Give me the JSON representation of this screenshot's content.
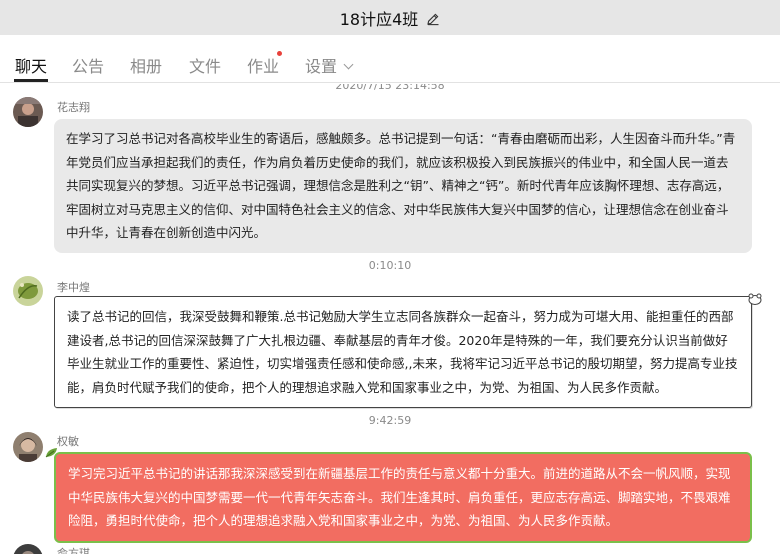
{
  "header": {
    "title": "18计应4班"
  },
  "tabs": [
    {
      "label": "聊天"
    },
    {
      "label": "公告"
    },
    {
      "label": "相册"
    },
    {
      "label": "文件"
    },
    {
      "label": "作业"
    },
    {
      "label": "设置"
    }
  ],
  "colors": {
    "active_tab": "#111111",
    "inactive_tab": "#8a8a8a",
    "notification_dot": "#e8413b",
    "bubble_gray": "#e9e9e9",
    "bubble_red": "#f26d61",
    "bubble_red_border": "#7bbf4a"
  },
  "chat": {
    "top_timestamp": "2020/7/15 23:14:58",
    "messages": [
      {
        "sender": "花志翔",
        "avatar_icon": "photo-avatar",
        "text": "在学习了习总书记对各高校毕业生的寄语后，感触颇多。总书记提到一句话：“青春由磨砺而出彩，人生因奋斗而升华。”青年党员们应当承担起我们的责任，作为肩负着历史使命的我们，就应该积极投入到民族振兴的伟业中，和全国人民一道去共同实现复兴的梦想。习近平总书记强调，理想信念是胜利之“钥”、精神之“钙”。新时代青年应该胸怀理想、志存高远，牢固树立对马克思主义的信仰、对中国特色社会主义的信念、对中华民族伟大复兴中国梦的信心，让理想信念在创业奋斗中升华，让青春在创新创造中闪光。"
      },
      {
        "timestamp": "0:10:10",
        "sender": "李中煌",
        "avatar_icon": "leaf-avatar",
        "text": "读了总书记的回信，我深受鼓舞和鞭策.总书记勉励大学生立志同各族群众一起奋斗，努力成为可堪大用、能担重任的西部建设者,总书记的回信深深鼓舞了广大扎根边疆、奉献基层的青年才俊。2020年是特殊的一年，我们要充分认识当前做好毕业生就业工作的重要性、紧迫性，切实增强责任感和使命感,,未来，我将牢记习近平总书记的殷切期望，努力提高专业技能，肩负时代赋予我们的使命，把个人的理想追求融入党和国家事业之中，为党、为祖国、为人民多作贡献。"
      },
      {
        "timestamp": "9:42:59",
        "sender": "权敏",
        "avatar_icon": "photo-avatar",
        "text": "学习完习近平总书记的讲话那我深深感受到在新疆基层工作的责任与意义都十分重大。前进的道路从不会一帆风顺，实现中华民族伟大复兴的中国梦需要一代一代青年矢志奋斗。我们生逢其时、肩负重任，更应志存高远、脚踏实地，不畏艰难险阻，勇担时代使命，把个人的理想追求融入党和国家事业之中，为党、为祖国、为人民多作贡献。"
      },
      {
        "sender": "俞方琪",
        "avatar_icon": "photo-avatar"
      }
    ]
  }
}
